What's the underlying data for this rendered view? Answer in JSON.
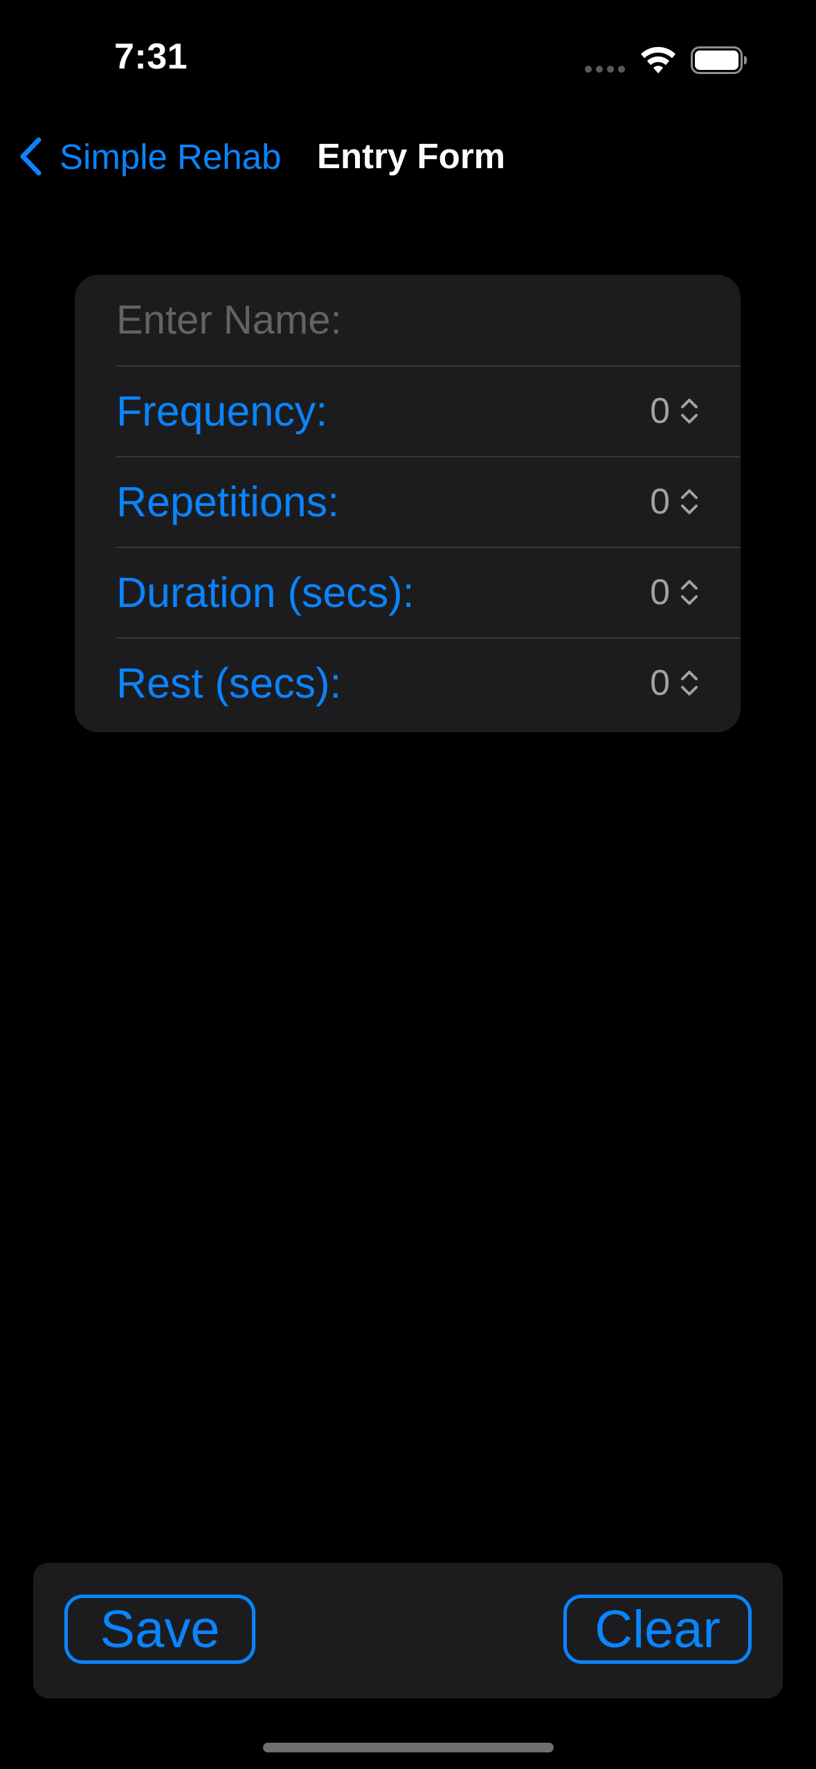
{
  "status_bar": {
    "time": "7:31",
    "signal_icon": "cellular-dots-icon",
    "wifi_icon": "wifi-icon",
    "battery_icon": "battery-icon"
  },
  "nav": {
    "back_label": "Simple Rehab",
    "back_icon": "chevron-left-icon",
    "title": "Entry Form"
  },
  "form": {
    "name_placeholder": "Enter Name:",
    "name_value": "",
    "rows": [
      {
        "label": "Frequency:",
        "value": "0"
      },
      {
        "label": "Repetitions:",
        "value": "0"
      },
      {
        "label": "Duration (secs):",
        "value": "0"
      },
      {
        "label": "Rest (secs):",
        "value": "0"
      }
    ]
  },
  "toolbar": {
    "save_label": "Save",
    "clear_label": "Clear"
  },
  "colors": {
    "accent": "#0a84ff",
    "background": "#000000",
    "card": "#1c1c1e",
    "separator": "#38383a",
    "placeholder": "#636366",
    "value": "#a1a1a6"
  }
}
